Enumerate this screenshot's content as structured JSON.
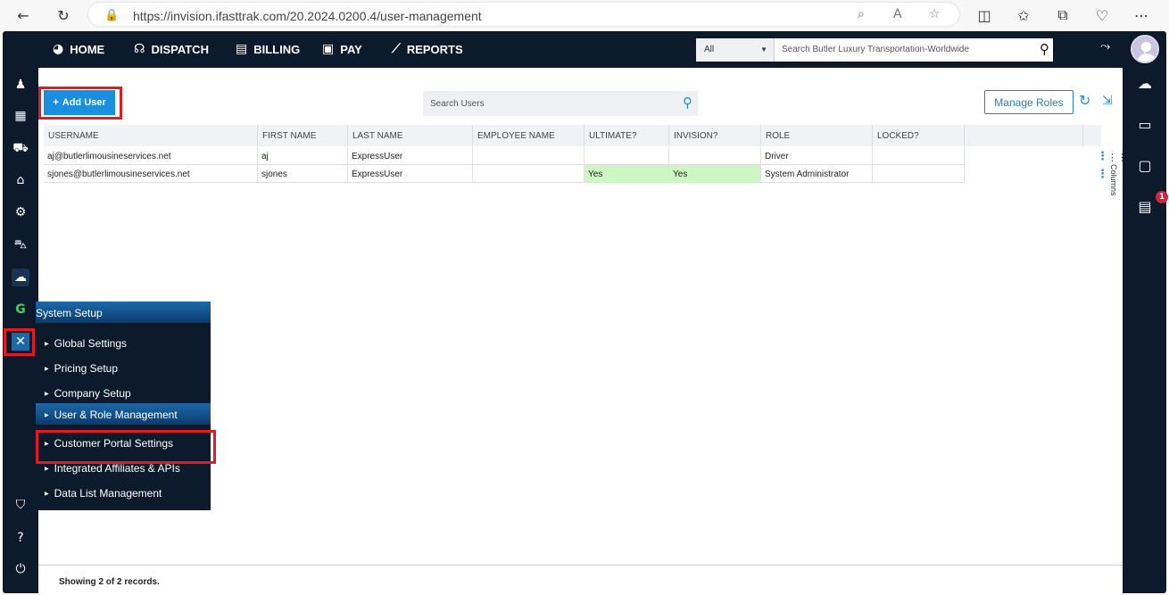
{
  "browser": {
    "url": "https://invision.ifasttrak.com/20.2024.0200.4/user-management"
  },
  "nav": {
    "home": "HOME",
    "dispatch": "DISPATCH",
    "billing": "BILLING",
    "pay": "PAY",
    "reports": "REPORTS"
  },
  "global_search": {
    "scope": "All",
    "placeholder": "Search Butler Luxury Transportation-Worldwide"
  },
  "toolbar": {
    "add_user": "Add User",
    "search_placeholder": "Search Users",
    "manage_roles": "Manage Roles"
  },
  "grid": {
    "columns": [
      "USERNAME",
      "FIRST NAME",
      "LAST NAME",
      "EMPLOYEE NAME",
      "ULTIMATE?",
      "INVISION?",
      "ROLE",
      "LOCKED?"
    ],
    "rows": [
      {
        "username": "aj@butlerlimousineservices.net",
        "first_name": "aj",
        "last_name": "ExpressUser",
        "employee_name": "",
        "ultimate": "",
        "invision": "",
        "role": "Driver",
        "locked": ""
      },
      {
        "username": "sjones@butlerlimousineservices.net",
        "first_name": "sjones",
        "last_name": "ExpressUser",
        "employee_name": "",
        "ultimate": "Yes",
        "invision": "Yes",
        "role": "System Administrator",
        "locked": ""
      }
    ],
    "columns_panel_label": "Columns",
    "highlight_color": "#ccf7c2"
  },
  "footer": {
    "records": "Showing 2 of 2 records."
  },
  "system_menu": {
    "title": "System Setup",
    "items": [
      "Global Settings",
      "Pricing Setup",
      "Company Setup",
      "User & Role Management",
      "Customer Portal Settings",
      "Integrated Affiliates & APIs",
      "Data List Management"
    ],
    "active": "User & Role Management"
  },
  "notifications": {
    "count": "1"
  },
  "colors": {
    "accent": "#1a8fe0",
    "sidebar": "#0c1a2b",
    "highlight_box": "#e01b24"
  }
}
